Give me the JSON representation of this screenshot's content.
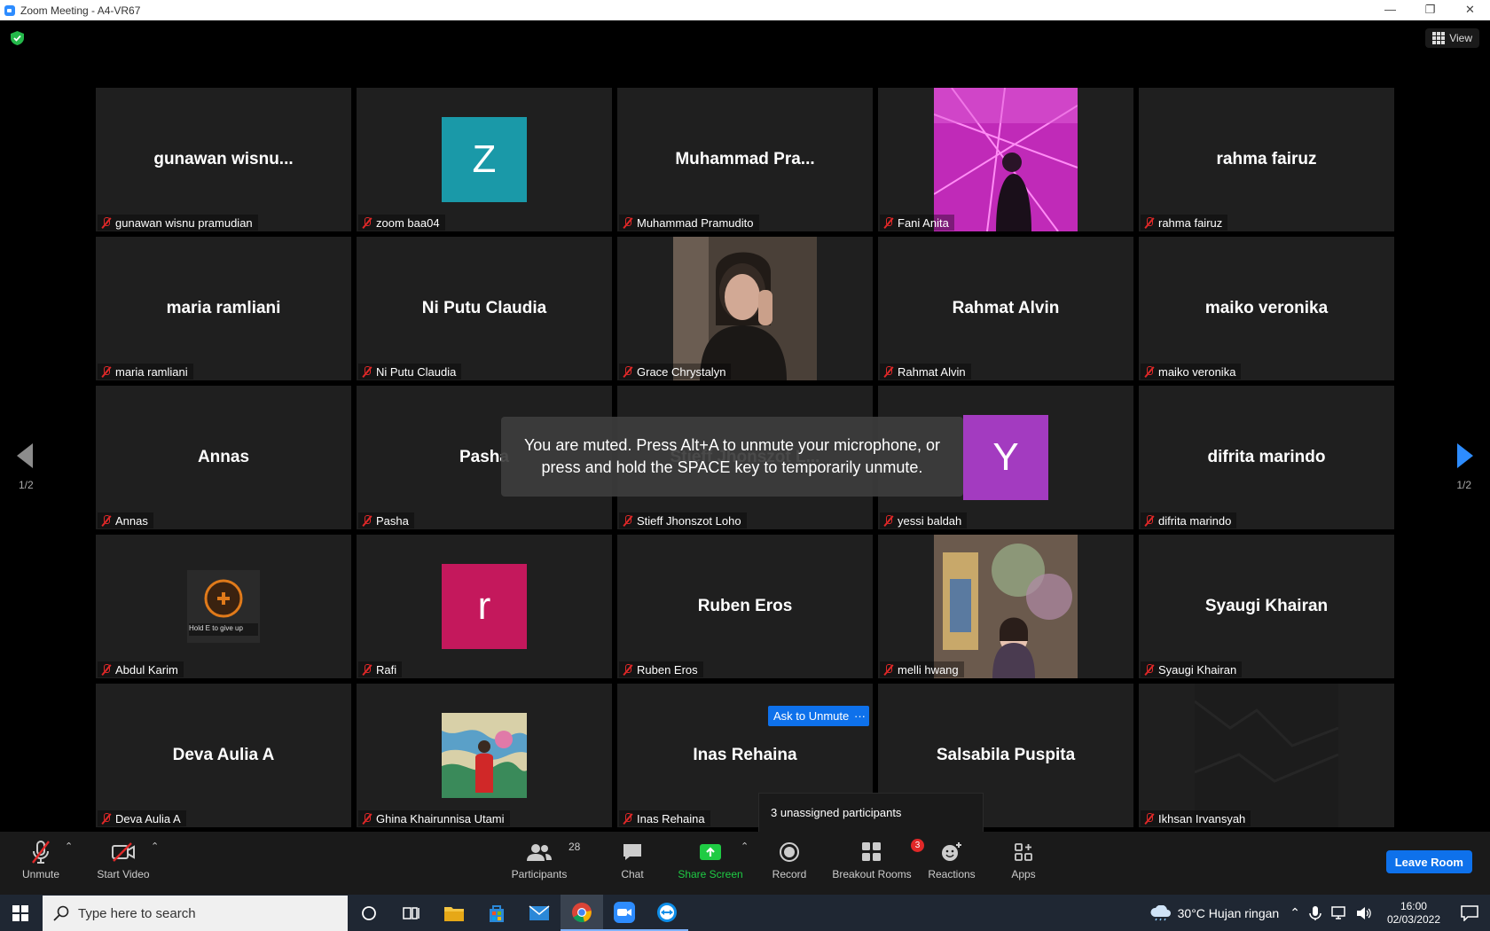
{
  "window": {
    "title": "Zoom Meeting - A4-VR67",
    "min": "—",
    "restore": "❐",
    "close": "✕"
  },
  "meeting": {
    "view_label": "View",
    "page_left": "1/2",
    "page_right": "1/2",
    "toast": "You are muted. Press Alt+A to unmute your microphone, or press and hold the SPACE key to temporarily unmute.",
    "ask_to_unmute": "Ask to Unmute",
    "more": "···",
    "unassigned": "3 unassigned participants",
    "abdul_overlay": "Hold E to give up"
  },
  "tiles": [
    {
      "name": "gunawan  wisnu...",
      "label": "gunawan wisnu pramudian"
    },
    {
      "name": "",
      "label": "zoom baa04",
      "avatar_letter": "Z",
      "avatar_color": "#1a99a8"
    },
    {
      "name": "Muhammad  Pra...",
      "label": "Muhammad Pramudito"
    },
    {
      "name": "",
      "label": "Fani Anita"
    },
    {
      "name": "rahma fairuz",
      "label": "rahma fairuz"
    },
    {
      "name": "maria ramliani",
      "label": "maria ramliani"
    },
    {
      "name": "Ni Putu Claudia",
      "label": "Ni Putu Claudia"
    },
    {
      "name": "",
      "label": "Grace Chrystalyn"
    },
    {
      "name": "Rahmat Alvin",
      "label": "Rahmat Alvin"
    },
    {
      "name": "maiko veronika",
      "label": "maiko veronika"
    },
    {
      "name": "Annas",
      "label": "Annas"
    },
    {
      "name": "Pasha",
      "label": "Pasha"
    },
    {
      "name": "Stieff  Jhonszot  L...",
      "label": "Stieff Jhonszot Loho"
    },
    {
      "name": "",
      "label": "yessi baldah",
      "avatar_letter": "Y",
      "avatar_color": "#a33bc0"
    },
    {
      "name": "difrita marindo",
      "label": "difrita marindo"
    },
    {
      "name": "",
      "label": "Abdul Karim"
    },
    {
      "name": "",
      "label": "Rafi",
      "avatar_letter": "r",
      "avatar_color": "#c4185c"
    },
    {
      "name": "Ruben Eros",
      "label": "Ruben Eros"
    },
    {
      "name": "",
      "label": "melli hwang"
    },
    {
      "name": "Syaugi Khairan",
      "label": "Syaugi Khairan"
    },
    {
      "name": "Deva Aulia A",
      "label": "Deva Aulia A"
    },
    {
      "name": "",
      "label": "Ghina Khairunnisa Utami"
    },
    {
      "name": "Inas Rehaina",
      "label": "Inas Rehaina"
    },
    {
      "name": "Salsabila Puspita",
      "label": ""
    },
    {
      "name": "",
      "label": "Ikhsan Irvansyah"
    }
  ],
  "toolbar": {
    "unmute": "Unmute",
    "start_video": "Start Video",
    "participants": "Participants",
    "participants_count": "28",
    "chat": "Chat",
    "share_screen": "Share Screen",
    "record": "Record",
    "breakout_rooms": "Breakout Rooms",
    "breakout_badge": "3",
    "reactions": "Reactions",
    "apps": "Apps",
    "leave": "Leave Room",
    "caret": "⌃"
  },
  "taskbar": {
    "search_placeholder": "Type here to search",
    "weather": "30°C  Hujan ringan",
    "time": "16:00",
    "date": "02/03/2022"
  },
  "colors": {
    "accent": "#0e71eb",
    "muted": "#e02828",
    "share": "#1fcb44",
    "tile": "#1f1f1f"
  }
}
